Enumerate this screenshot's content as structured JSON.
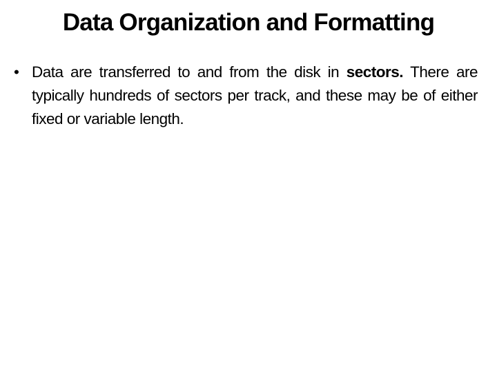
{
  "slide": {
    "title": "Data Organization and Formatting",
    "bullets": [
      {
        "marker": "•",
        "text_before": "Data are transferred to and from the disk in ",
        "bold_term": "sectors.",
        "text_after": " There are typically hundreds of sectors per track, and these may be of either fixed or variable length."
      }
    ]
  }
}
